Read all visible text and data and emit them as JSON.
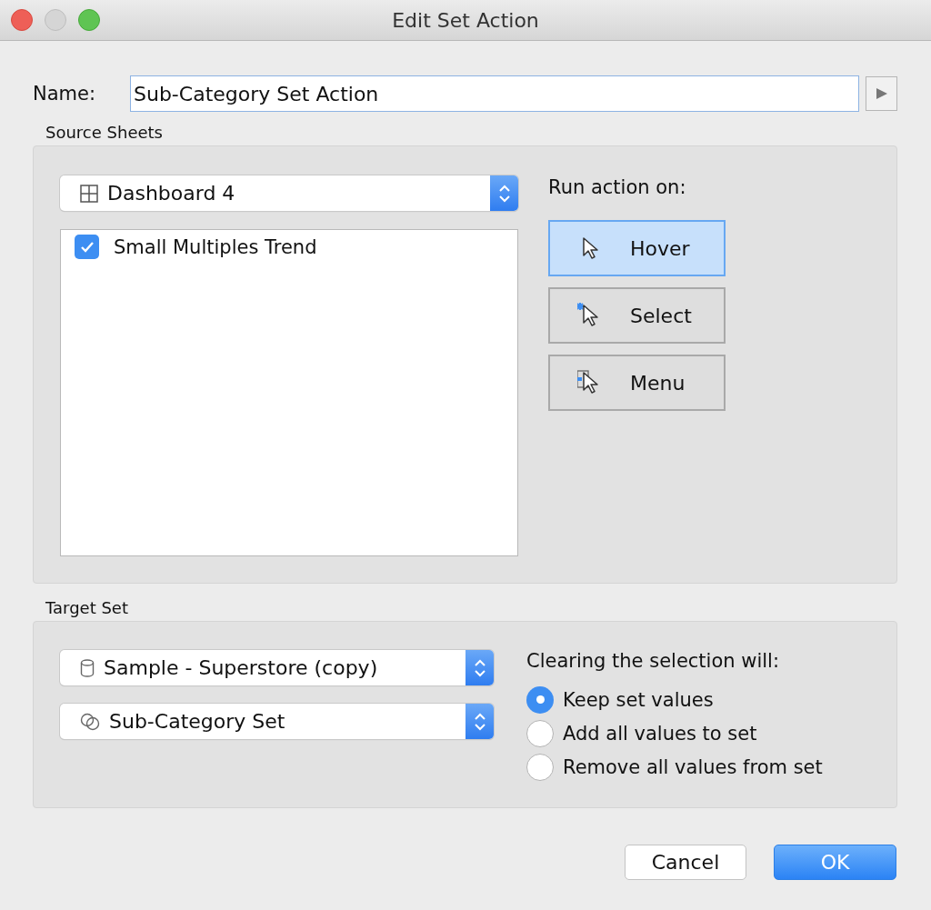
{
  "window": {
    "title": "Edit Set Action"
  },
  "name_field": {
    "label": "Name:",
    "value": "Sub-Category Set Action"
  },
  "source_sheets": {
    "title": "Source Sheets",
    "dropdown": {
      "kind": "dashboard",
      "value": "Dashboard 4"
    },
    "sheets": [
      {
        "label": "Small Multiples Trend",
        "checked": true
      }
    ],
    "run_action": {
      "label": "Run action on:",
      "options": [
        {
          "kind": "hover",
          "label": "Hover",
          "selected": true
        },
        {
          "kind": "select",
          "label": "Select",
          "selected": false
        },
        {
          "kind": "menu",
          "label": "Menu",
          "selected": false
        }
      ]
    }
  },
  "target_set": {
    "title": "Target Set",
    "dropdowns": [
      {
        "kind": "datasource",
        "value": "Sample - Superstore (copy)"
      },
      {
        "kind": "set",
        "value": "Sub-Category Set"
      }
    ],
    "clearing": {
      "label": "Clearing the selection will:",
      "options": [
        {
          "label": "Keep set values",
          "selected": true
        },
        {
          "label": "Add all values to set",
          "selected": false
        },
        {
          "label": "Remove all values from set",
          "selected": false
        }
      ]
    }
  },
  "buttons": [
    {
      "kind": "default",
      "label": "Cancel"
    },
    {
      "kind": "primary",
      "label": "OK"
    }
  ]
}
